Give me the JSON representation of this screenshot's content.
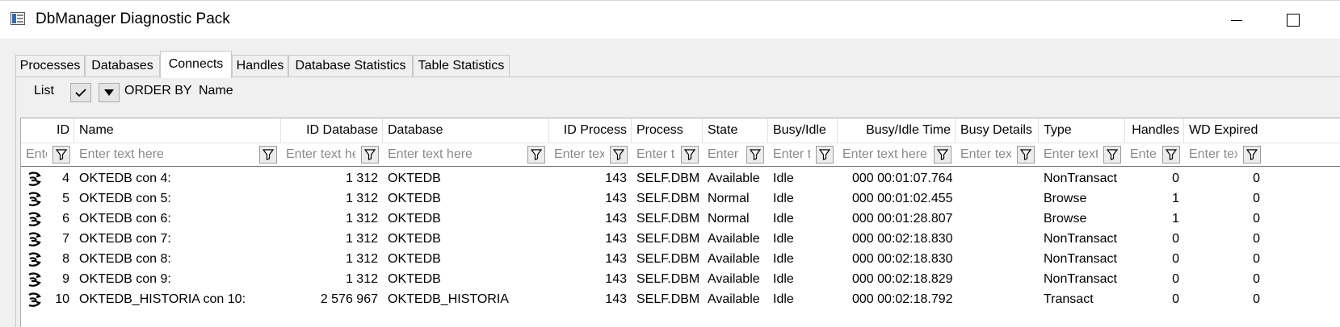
{
  "window": {
    "title": "DbManager Diagnostic Pack"
  },
  "tabs": [
    "Processes",
    "Databases",
    "Connects",
    "Handles",
    "Database Statistics",
    "Table Statistics"
  ],
  "toolbar": {
    "list_label": "List",
    "order_by_label": "ORDER BY",
    "order_by_value": "Name"
  },
  "grid": {
    "columns": [
      {
        "key": "icon",
        "label": ""
      },
      {
        "key": "id",
        "label": "ID"
      },
      {
        "key": "name",
        "label": "Name"
      },
      {
        "key": "id_database",
        "label": "ID Database"
      },
      {
        "key": "database",
        "label": "Database"
      },
      {
        "key": "id_process",
        "label": "ID Process"
      },
      {
        "key": "process",
        "label": "Process"
      },
      {
        "key": "state",
        "label": "State"
      },
      {
        "key": "busy_idle",
        "label": "Busy/Idle"
      },
      {
        "key": "busy_idle_time",
        "label": "Busy/Idle Time"
      },
      {
        "key": "busy_details",
        "label": "Busy Details"
      },
      {
        "key": "type",
        "label": "Type"
      },
      {
        "key": "handles",
        "label": "Handles"
      },
      {
        "key": "wd_expired",
        "label": "WD Expired"
      }
    ],
    "filter_placeholder": "Enter text here",
    "rows": [
      {
        "id": "4",
        "name": "OKTEDB con 4:",
        "id_database": "1 312",
        "database": "OKTEDB",
        "id_process": "143",
        "process": "SELF.DBM",
        "state": "Available",
        "busy_idle": "Idle",
        "busy_idle_time": "000 00:01:07.764",
        "busy_details": "",
        "type": "NonTransact",
        "handles": "0",
        "wd_expired": "0"
      },
      {
        "id": "5",
        "name": "OKTEDB con 5:",
        "id_database": "1 312",
        "database": "OKTEDB",
        "id_process": "143",
        "process": "SELF.DBM",
        "state": "Normal",
        "busy_idle": "Idle",
        "busy_idle_time": "000 00:01:02.455",
        "busy_details": "",
        "type": "Browse",
        "handles": "1",
        "wd_expired": "0"
      },
      {
        "id": "6",
        "name": "OKTEDB con 6:",
        "id_database": "1 312",
        "database": "OKTEDB",
        "id_process": "143",
        "process": "SELF.DBM",
        "state": "Normal",
        "busy_idle": "Idle",
        "busy_idle_time": "000 00:01:28.807",
        "busy_details": "",
        "type": "Browse",
        "handles": "1",
        "wd_expired": "0"
      },
      {
        "id": "7",
        "name": "OKTEDB con 7:",
        "id_database": "1 312",
        "database": "OKTEDB",
        "id_process": "143",
        "process": "SELF.DBM",
        "state": "Available",
        "busy_idle": "Idle",
        "busy_idle_time": "000 00:02:18.830",
        "busy_details": "",
        "type": "NonTransact",
        "handles": "0",
        "wd_expired": "0"
      },
      {
        "id": "8",
        "name": "OKTEDB con 8:",
        "id_database": "1 312",
        "database": "OKTEDB",
        "id_process": "143",
        "process": "SELF.DBM",
        "state": "Available",
        "busy_idle": "Idle",
        "busy_idle_time": "000 00:02:18.830",
        "busy_details": "",
        "type": "NonTransact",
        "handles": "0",
        "wd_expired": "0"
      },
      {
        "id": "9",
        "name": "OKTEDB con 9:",
        "id_database": "1 312",
        "database": "OKTEDB",
        "id_process": "143",
        "process": "SELF.DBM",
        "state": "Available",
        "busy_idle": "Idle",
        "busy_idle_time": "000 00:02:18.829",
        "busy_details": "",
        "type": "NonTransact",
        "handles": "0",
        "wd_expired": "0"
      },
      {
        "id": "10",
        "name": "OKTEDB_HISTORIA con 10:",
        "id_database": "2 576 967",
        "database": "OKTEDB_HISTORIA",
        "id_process": "143",
        "process": "SELF.DBM",
        "state": "Available",
        "busy_idle": "Idle",
        "busy_idle_time": "000 00:02:18.792",
        "busy_details": "",
        "type": "Transact",
        "handles": "0",
        "wd_expired": "0"
      }
    ]
  },
  "icons": {
    "app": "app-window-icon",
    "minimize": "minimize-icon",
    "maximize": "maximize-icon",
    "list_check": "checkmark-icon",
    "dropdown": "dropdown-arrow-icon",
    "filter": "filter-funnel-icon",
    "row": "connection-icon"
  }
}
